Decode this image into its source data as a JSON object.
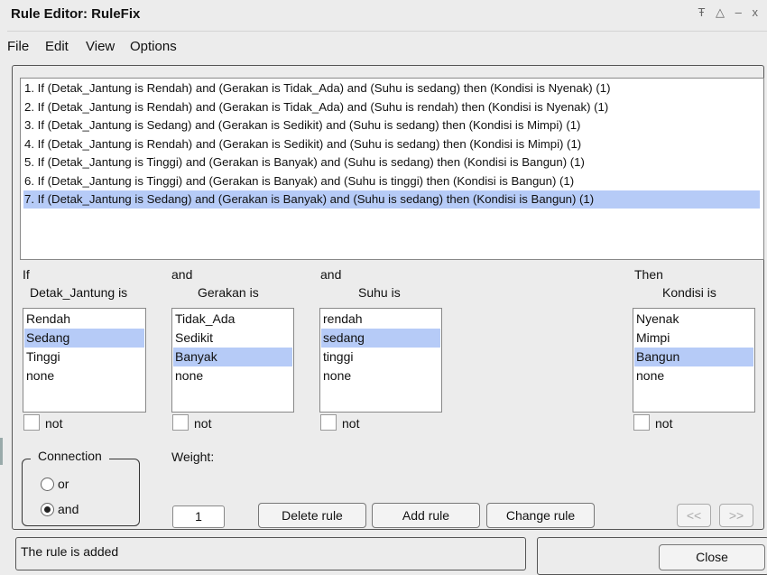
{
  "window": {
    "title": "Rule Editor: RuleFix",
    "icons": [
      "pin-icon",
      "maximize-icon",
      "minimize-icon",
      "close-icon"
    ],
    "icon_glyphs": "Ŧ △ – x"
  },
  "menu": [
    "File",
    "Edit",
    "View",
    "Options"
  ],
  "rules": [
    "1. If (Detak_Jantung is Rendah) and (Gerakan is Tidak_Ada) and (Suhu is sedang) then (Kondisi is Nyenak) (1)",
    "2. If (Detak_Jantung is Rendah) and (Gerakan is Tidak_Ada) and (Suhu is rendah) then (Kondisi is Nyenak) (1)",
    "3. If (Detak_Jantung is Sedang) and (Gerakan is Sedikit) and (Suhu is sedang) then (Kondisi is Mimpi) (1)",
    "4. If (Detak_Jantung is Rendah) and (Gerakan is Sedikit) and (Suhu is sedang) then (Kondisi is Mimpi) (1)",
    "5. If (Detak_Jantung is Tinggi) and (Gerakan is Banyak) and (Suhu is sedang) then (Kondisi is Bangun) (1)",
    "6. If (Detak_Jantung is Tinggi) and (Gerakan is Banyak) and (Suhu is tinggi) then (Kondisi is Bangun) (1)",
    "7. If (Detak_Jantung is Sedang) and (Gerakan is Banyak) and (Suhu is sedang) then (Kondisi is Bangun) (1)"
  ],
  "selected_rule_index": 6,
  "inputs": [
    {
      "prefix": "If",
      "label": "Detak_Jantung is",
      "options": [
        "Rendah",
        "Sedang",
        "Tinggi",
        "none"
      ],
      "selected": 1,
      "not_label": "not"
    },
    {
      "prefix": "and",
      "label": "Gerakan is",
      "options": [
        "Tidak_Ada",
        "Sedikit",
        "Banyak",
        "none"
      ],
      "selected": 2,
      "not_label": "not"
    },
    {
      "prefix": "and",
      "label": "Suhu is",
      "options": [
        "rendah",
        "sedang",
        "tinggi",
        "none"
      ],
      "selected": 1,
      "not_label": "not"
    }
  ],
  "output": {
    "prefix": "Then",
    "label": "Kondisi is",
    "options": [
      "Nyenak",
      "Mimpi",
      "Bangun",
      "none"
    ],
    "selected": 2,
    "not_label": "not"
  },
  "connection": {
    "title": "Connection",
    "options": [
      "or",
      "and"
    ],
    "selected": "and"
  },
  "weight": {
    "label": "Weight:",
    "value": "1"
  },
  "buttons": {
    "delete": "Delete rule",
    "add": "Add rule",
    "change": "Change rule",
    "prev": "<<",
    "next": ">>",
    "close": "Close"
  },
  "status": "The rule is added"
}
